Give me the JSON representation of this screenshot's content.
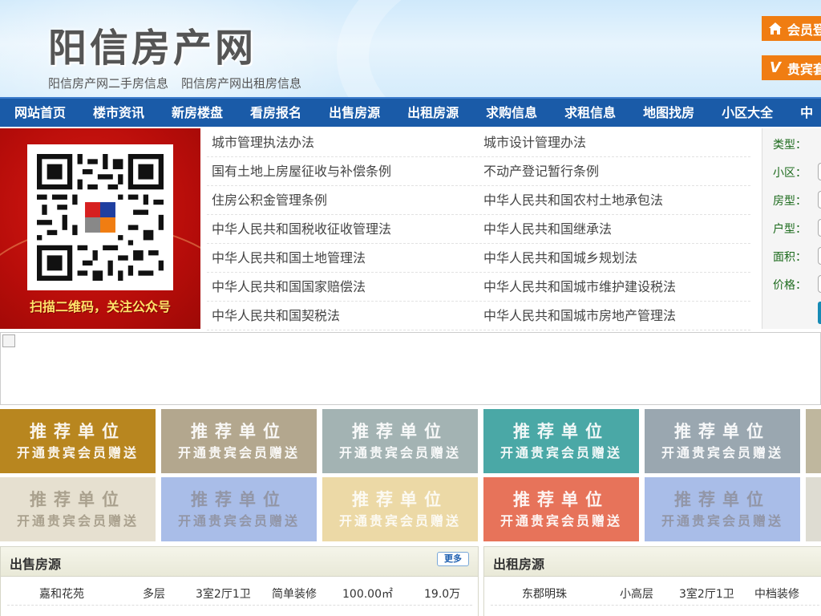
{
  "header": {
    "title": "阳信房产网",
    "links": [
      "阳信房产网二手房信息",
      "阳信房产网出租房信息"
    ],
    "login_btn": "会员登",
    "vip_btn": "贵宾套",
    "vip_icon_text": "V",
    "accent_color": "#f07d12"
  },
  "nav": {
    "items": [
      "网站首页",
      "楼市资讯",
      "新房楼盘",
      "看房报名",
      "出售房源",
      "出租房源",
      "求购信息",
      "求租信息",
      "地图找房",
      "小区大全",
      "中"
    ],
    "bg_color": "#1a5ba8"
  },
  "qr": {
    "caption": "扫描二维码，关注公众号"
  },
  "laws": [
    [
      "城市管理执法办法",
      "城市设计管理办法"
    ],
    [
      "国有土地上房屋征收与补偿条例",
      "不动产登记暂行条例"
    ],
    [
      "住房公积金管理条例",
      "中华人民共和国农村土地承包法"
    ],
    [
      "中华人民共和国税收征收管理法",
      "中华人民共和国继承法"
    ],
    [
      "中华人民共和国土地管理法",
      "中华人民共和国城乡规划法"
    ],
    [
      "中华人民共和国国家赔偿法",
      "中华人民共和国城市维护建设税法"
    ],
    [
      "中华人民共和国契税法",
      "中华人民共和国城市房地产管理法"
    ]
  ],
  "search": {
    "labels": [
      "类型：",
      "小区：",
      "房型：",
      "户型：",
      "面积：",
      "价格："
    ]
  },
  "ads": {
    "line1": "推荐单位",
    "line2": "开通贵宾会员赠送",
    "row1_colors": [
      "#b8861f",
      "#b3a78e",
      "#a3b3b3",
      "#4aa8a6",
      "#9aa7b0",
      "#bfb79e"
    ],
    "row2_colors": [
      "#e6e0d0",
      "#a9bde8",
      "#ecd9a6",
      "#e7735a",
      "#a9bde8",
      "#dedcd2"
    ]
  },
  "sale": {
    "title": "出售房源",
    "more": "更多",
    "rows": [
      [
        "嘉和花苑",
        "多层",
        "3室2厅1卫",
        "简单装修",
        "100.00㎡",
        "19.0万"
      ]
    ]
  },
  "rent": {
    "title": "出租房源",
    "rows": [
      [
        "东郡明珠",
        "小高层",
        "3室2厅1卫",
        "中档装修"
      ]
    ]
  }
}
